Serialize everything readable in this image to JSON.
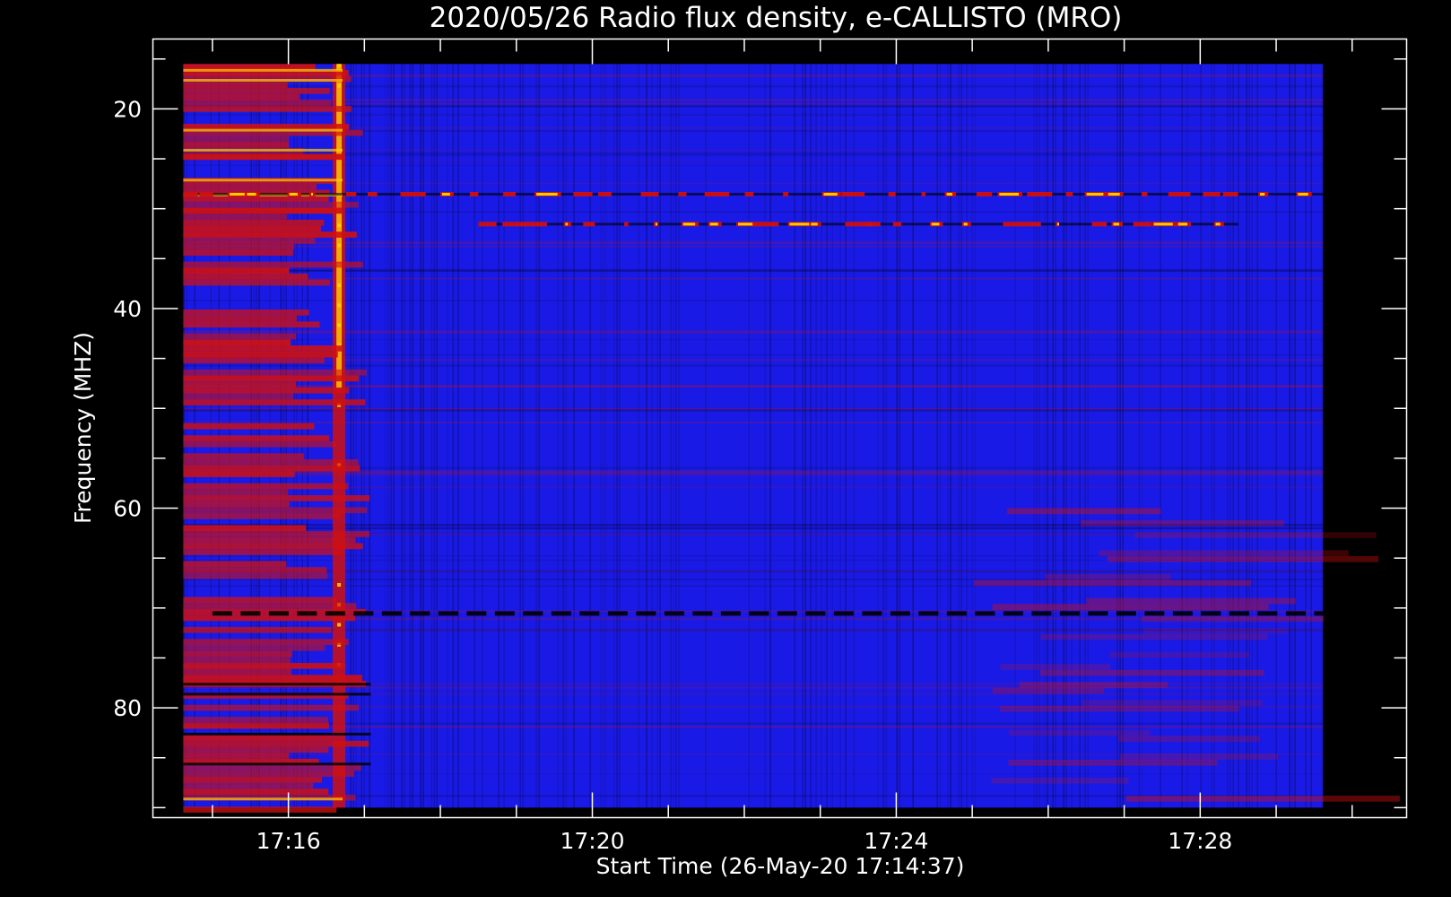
{
  "chart_data": {
    "type": "heatmap",
    "title": "2020/05/26  Radio flux density, e-CALLISTO (MRO)",
    "xlabel": "Start Time (26-May-20 17:14:37)",
    "ylabel": "Frequency (MHZ)",
    "x_axis": {
      "unit": "time",
      "range": [
        "17:14:13",
        "17:30:43"
      ],
      "data_range": [
        "17:14:37",
        "17:29:37"
      ],
      "major_ticks": [
        "17:16",
        "17:20",
        "17:24",
        "17:28"
      ],
      "minor_tick_step_minutes": 1
    },
    "y_axis": {
      "unit": "MHz",
      "range": [
        91,
        13
      ],
      "inverted": true,
      "data_range": [
        15.5,
        90
      ],
      "major_ticks": [
        20,
        40,
        60,
        80
      ],
      "minor_tick_step": 5
    },
    "colormap": "red-temperature on blue background (black → blue → red → yellow → white)",
    "colors": {
      "background": "#000000",
      "base": "#1a1ae6",
      "low": "#000000",
      "enhanced": "#d01010",
      "high": "#ffd000",
      "axes": "#ffffff"
    },
    "features": [
      {
        "kind": "broadband burst",
        "time": "17:16:40",
        "freq_range_mhz": [
          15.5,
          90
        ],
        "intensity": "high"
      },
      {
        "kind": "elevated background (red)",
        "time_range": [
          "17:14:37",
          "17:17:05"
        ],
        "freq_range_mhz": [
          15.5,
          90
        ],
        "intensity": "medium"
      },
      {
        "kind": "narrowband interference",
        "freq_mhz": 28.5,
        "time_range": [
          "17:14:37",
          "17:29:37"
        ],
        "intensity": "high"
      },
      {
        "kind": "narrowband interference",
        "freq_mhz": 31.5,
        "time_range": [
          "17:18:30",
          "17:28:30"
        ],
        "intensity": "high"
      },
      {
        "kind": "periodic dropouts",
        "freq_mhz": 70.5,
        "time_range": [
          "17:15:00",
          "17:29:30"
        ],
        "intensity": "low"
      },
      {
        "kind": "elevated background (red)",
        "time_range": [
          "17:25:00",
          "17:29:37"
        ],
        "freq_range_mhz": [
          60,
          90
        ],
        "intensity": "medium"
      }
    ]
  }
}
